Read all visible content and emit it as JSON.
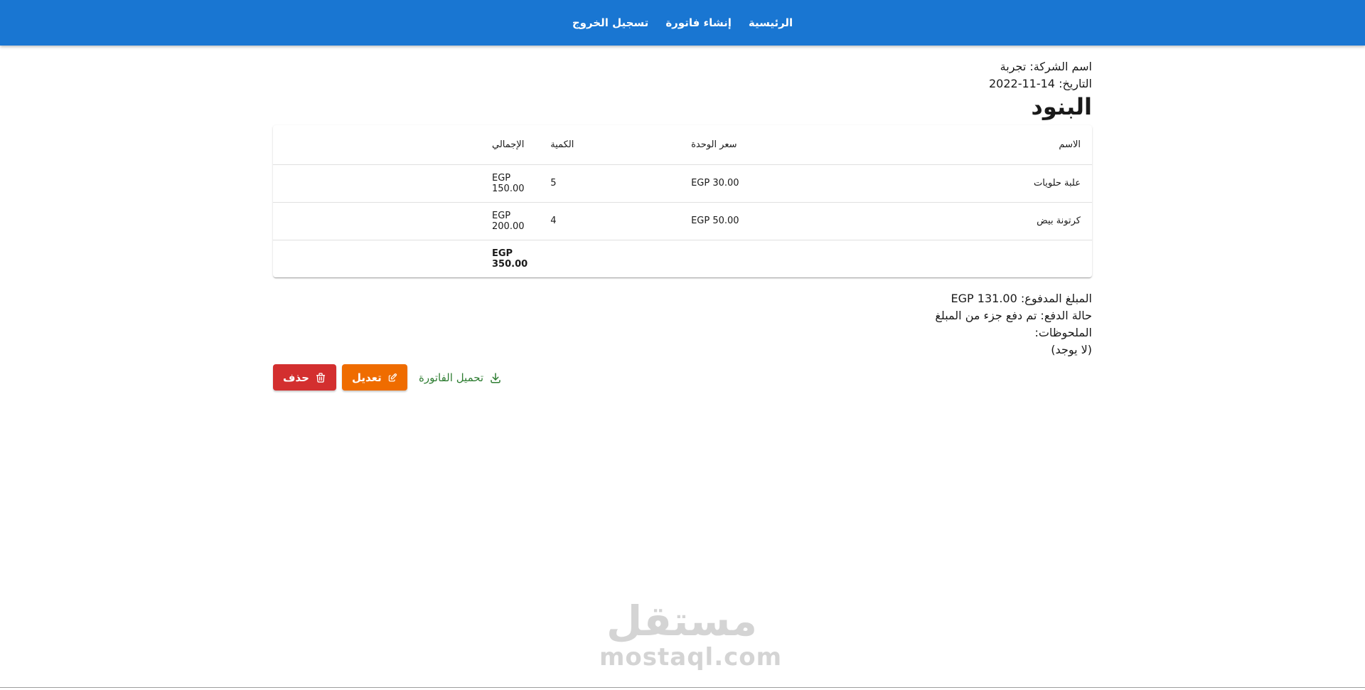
{
  "nav": {
    "home": "الرئيسية",
    "create_invoice": "إنشاء فاتورة",
    "logout": "تسجيل الخروج"
  },
  "invoice": {
    "company_label": "اسم الشركة:",
    "company_value": "تجربة",
    "date_label": "التاريخ:",
    "date_value": "2022-11-14",
    "items_title": "البنود"
  },
  "table": {
    "headers": {
      "name": "الاسم",
      "unit_price": "سعر الوحدة",
      "quantity": "الكمية",
      "total": "الإجمالي"
    },
    "rows": [
      {
        "name": "علبة حلويات",
        "unit_price": "EGP 30.00",
        "quantity": "5",
        "total": "EGP 150.00"
      },
      {
        "name": "كرتونة بيض",
        "unit_price": "EGP 50.00",
        "quantity": "4",
        "total": "EGP 200.00"
      }
    ],
    "grand_total": "EGP 350.00"
  },
  "summary": {
    "paid_label": "المبلغ المدفوع:",
    "paid_value": "EGP 131.00",
    "status_label": "حالة الدفع:",
    "status_value": "تم دفع جزء من المبلغ",
    "notes_label": "الملحوظات:",
    "notes_value": "(لا يوجد)"
  },
  "actions": {
    "delete": "حذف",
    "edit": "تعديل",
    "download": "تحميل الفاتورة"
  },
  "watermark": {
    "arabic": "مستقل",
    "latin": "mostaql.com"
  },
  "colors": {
    "appbar": "#1976d2",
    "delete": "#d32f2f",
    "edit": "#ef6c00",
    "download": "#2e7d32"
  }
}
